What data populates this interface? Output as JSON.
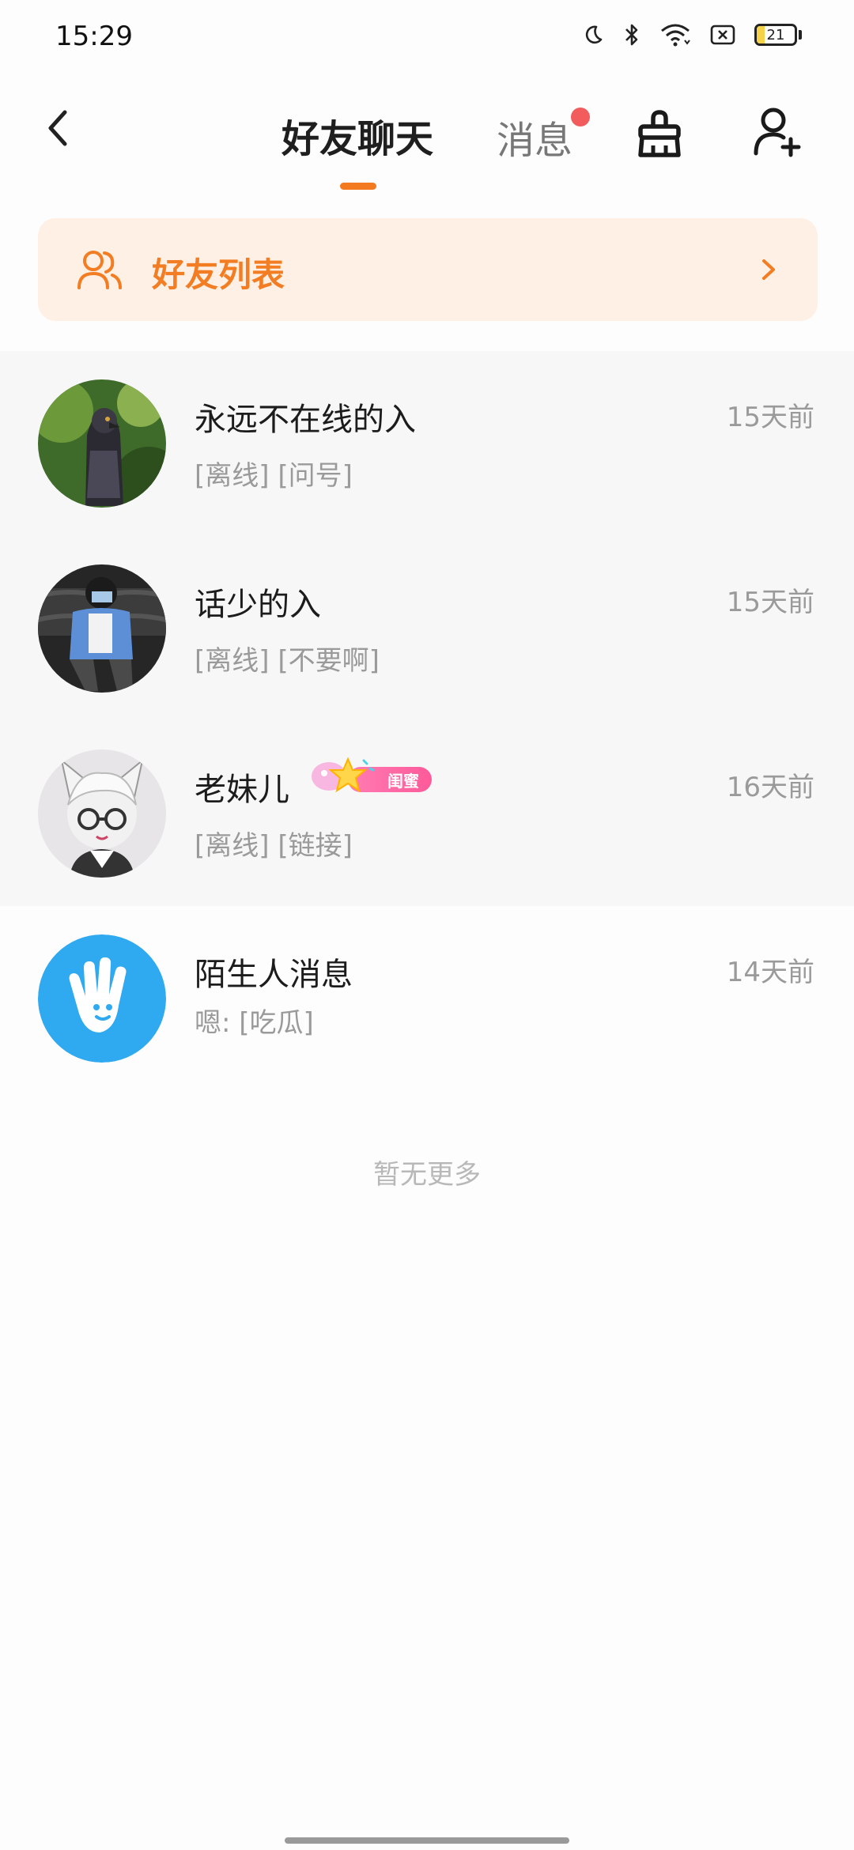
{
  "status_bar": {
    "time": "15:29",
    "battery_level": "21"
  },
  "header": {
    "tab_friends_label": "好友聊天",
    "tab_messages_label": "消息",
    "accent_color": "#f47a1f"
  },
  "friend_list": {
    "label": "好友列表"
  },
  "chats": [
    {
      "name": "永远不在线的入",
      "time": "15天前",
      "preview": "[离线] [问号]"
    },
    {
      "name": "话少的入",
      "time": "15天前",
      "preview": "[离线] [不要啊]"
    },
    {
      "name": "老妹儿",
      "badge": "闺蜜",
      "time": "16天前",
      "preview": "[离线] [链接]"
    }
  ],
  "stranger": {
    "name": "陌生人消息",
    "time": "14天前",
    "preview": "嗯: [吃瓜]"
  },
  "footer": {
    "no_more": "暂无更多"
  }
}
